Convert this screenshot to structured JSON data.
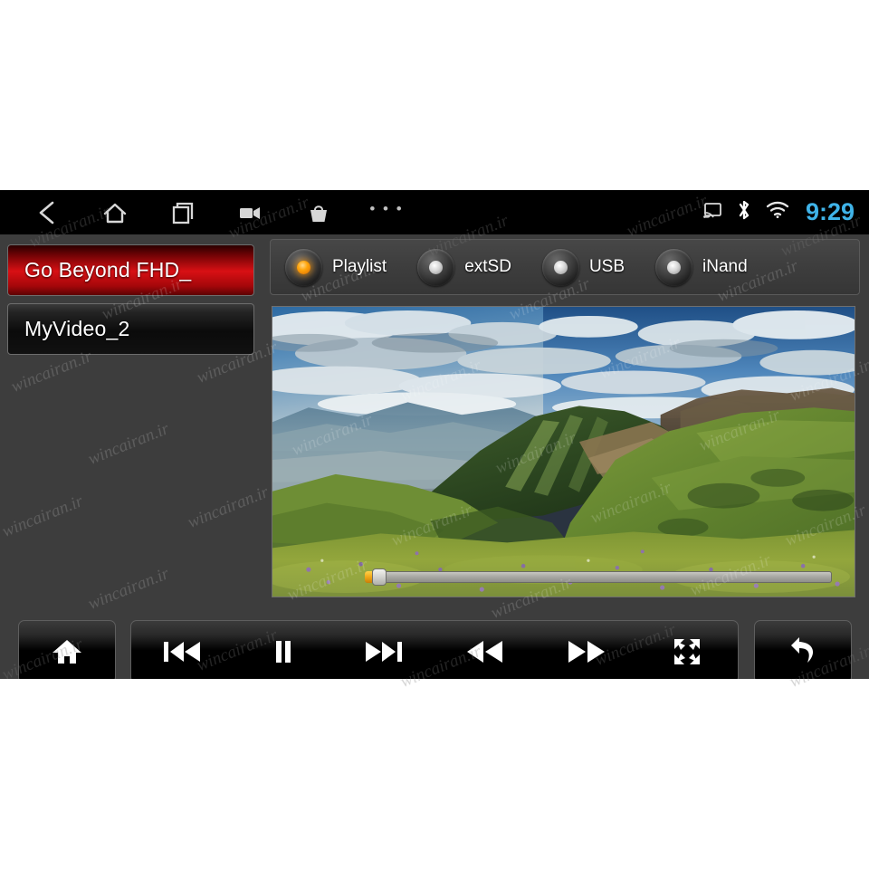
{
  "status_bar": {
    "nav_icons": [
      {
        "name": "back-icon",
        "glyph": "back"
      },
      {
        "name": "home-icon",
        "glyph": "home"
      },
      {
        "name": "recents-icon",
        "glyph": "recents"
      },
      {
        "name": "video-camera-icon",
        "glyph": "camcorder"
      },
      {
        "name": "shopping-bag-icon",
        "glyph": "bag"
      },
      {
        "name": "overflow-menu-icon",
        "glyph": "dots"
      }
    ],
    "overflow_label": "• • •",
    "system_icons": [
      {
        "name": "screen-cast-icon"
      },
      {
        "name": "bluetooth-icon"
      },
      {
        "name": "wifi-icon"
      }
    ],
    "clock": "9:29",
    "clock_color": "#3fb3e8"
  },
  "playlist": {
    "items": [
      {
        "label": "Go Beyond FHD_",
        "selected": true
      },
      {
        "label": "MyVideo_2",
        "selected": false
      }
    ],
    "selected_color": "#d81014"
  },
  "sources": {
    "options": [
      {
        "label": "Playlist",
        "selected": true
      },
      {
        "label": "extSD",
        "selected": false
      },
      {
        "label": "USB",
        "selected": false
      },
      {
        "label": "iNand",
        "selected": false
      }
    ],
    "active_indicator_color": "#ffa50c"
  },
  "video": {
    "name": "video-surface",
    "scene": "mountain-meadow-landscape",
    "seek": {
      "progress_percent": 1,
      "fill_color": "#f0a719",
      "track_color": "#a9a9a4"
    }
  },
  "transport": {
    "home_button": {
      "name": "home-button",
      "glyph": "home"
    },
    "controls": [
      {
        "name": "previous-track-button",
        "glyph": "prev"
      },
      {
        "name": "pause-button",
        "glyph": "pause"
      },
      {
        "name": "next-track-button",
        "glyph": "next"
      },
      {
        "name": "rewind-button",
        "glyph": "rewind"
      },
      {
        "name": "fast-forward-button",
        "glyph": "forward"
      },
      {
        "name": "fullscreen-button",
        "glyph": "fullscreen"
      }
    ],
    "back_button": {
      "name": "back-button",
      "glyph": "return"
    }
  },
  "watermark": {
    "text": "wincairan.ir"
  },
  "colors": {
    "app_background": "#3d3d3d",
    "panel_background": "#3e3e3e",
    "status_bar_background": "#000000"
  }
}
